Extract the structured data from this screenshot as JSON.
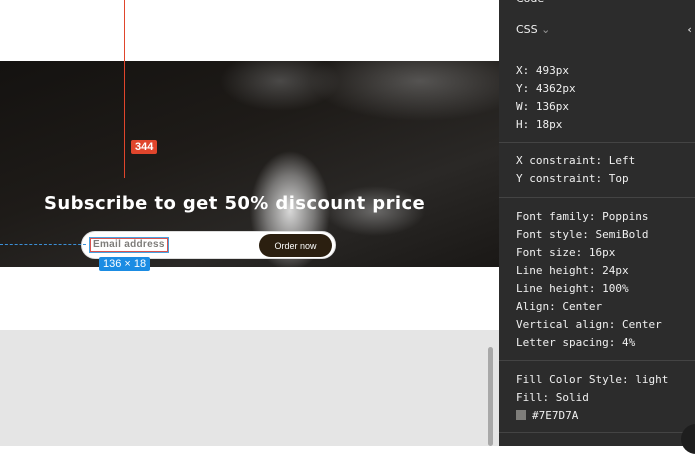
{
  "canvas": {
    "headline": "Subscribe to get 50% discount price",
    "email_placeholder": "Email address",
    "order_button": "Order now",
    "distance_badge": "344",
    "dimension_badge": "136 × 18"
  },
  "panel": {
    "section_title": "Code",
    "language": "CSS",
    "position": [
      "X: 493px",
      "Y: 4362px",
      "W: 136px",
      "H: 18px"
    ],
    "constraints": [
      "X constraint: Left",
      "Y constraint: Top"
    ],
    "typography": [
      "Font family: Poppins",
      "Font style: SemiBold",
      "Font size: 16px",
      "Line height: 24px",
      "Line height: 100%",
      "Align: Center",
      "Vertical align: Center",
      "Letter spacing: 4%"
    ],
    "fill": [
      "Fill Color Style: light",
      "Fill: Solid"
    ],
    "fill_color": "#7E7D7A"
  }
}
